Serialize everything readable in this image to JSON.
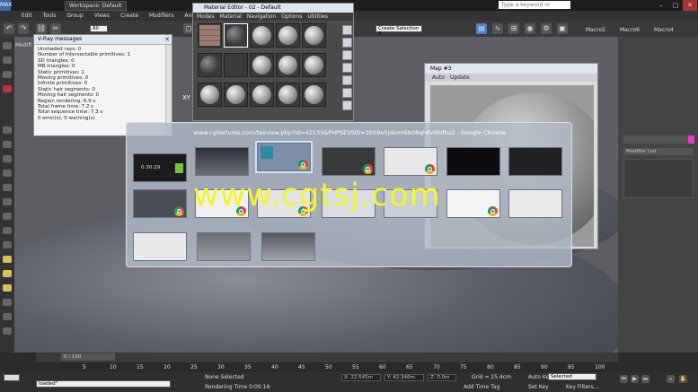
{
  "titlebar": {
    "workspace": "Workspace: Default",
    "search_placeholder": "Type a keyword or phrase"
  },
  "menubar": {
    "items": [
      "Edit",
      "Tools",
      "Group",
      "Views",
      "Create",
      "Modifiers",
      "Animati"
    ]
  },
  "toolbar": {
    "filter_dropdown": "All",
    "selection_set": "Create Selection S",
    "macros": [
      "Macro5",
      "Macro6",
      "Macro4"
    ]
  },
  "left_label": "Modifi",
  "vray_messages": {
    "title": "V-Ray messages",
    "lines": [
      "Unshaded rays: 0",
      "Number of intersectable primitives: 1",
      "SD triangles: 0",
      "MB triangles: 0",
      "Static primitives: 1",
      "Moving primitives: 0",
      "Infinite primitives: 0",
      "Static hair segments: 0",
      "Moving hair segments: 0",
      "Region rendering: 6.9 s",
      "Total frame time: 7.2 s",
      "Total sequence time: 7.3 s",
      "0 error(s), 0 warning(s)"
    ]
  },
  "material_editor": {
    "title": "Material Editor - 02 - Default",
    "menu": [
      "Modes",
      "Material",
      "Navigation",
      "Options",
      "Utilities"
    ]
  },
  "map_window": {
    "title": "Map #3",
    "tabs": [
      "Auto",
      "Update"
    ]
  },
  "switcher": {
    "title": "www.cgtextures.com/texview.php?id=42533&PHPSESSID=1b59e5jdemi6b08qh0v9hifku2 - Google Chrome",
    "thumb_time": "0:30:29"
  },
  "watermark": "www.cgtsj.com",
  "viewport_label": "XY",
  "right_panel": {
    "modifier_list": "Modifier List"
  },
  "timeline": {
    "frame": "0 / 100",
    "ticks": [
      "5",
      "10",
      "15",
      "20",
      "25",
      "30",
      "35",
      "40",
      "45",
      "50",
      "55",
      "60",
      "65",
      "70",
      "75",
      "80",
      "85",
      "90",
      "95",
      "100"
    ]
  },
  "status": {
    "script_text": "loaded\"",
    "selection": "None Selected",
    "render_time": "Rendering Time  0:00:16",
    "x_value": "X: 22.545m",
    "y_value": "Y: 42.346m",
    "z_value": "Z: 0.0m",
    "grid": "Grid = 25.4cm",
    "add_time_tag": "Add Time Tag",
    "auto_key": "Auto Key",
    "auto_key_value": "Selected",
    "set_key": "Set Key",
    "key_filters": "Key Filters..."
  }
}
